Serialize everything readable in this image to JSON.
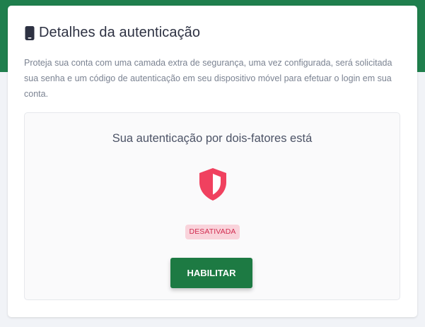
{
  "card": {
    "title": "Detalhes da autenticação",
    "title_icon": "phone-icon",
    "description": "Proteja sua conta com uma camada extra de segurança, uma vez configurada, será solicitada sua senha e um código de autenticação em seu dispositivo móvel para efetuar o login em sua conta."
  },
  "status": {
    "heading": "Sua autenticação por dois-fatores está",
    "icon": "shield-icon",
    "badge": "DESATIVADA",
    "button_label": "HABILITAR"
  },
  "colors": {
    "brand_green": "#1f7f4d",
    "button_green": "#1d7a43",
    "shield_red": "#f0415f",
    "badge_bg": "#f9d3db",
    "badge_text": "#d12b4f"
  }
}
